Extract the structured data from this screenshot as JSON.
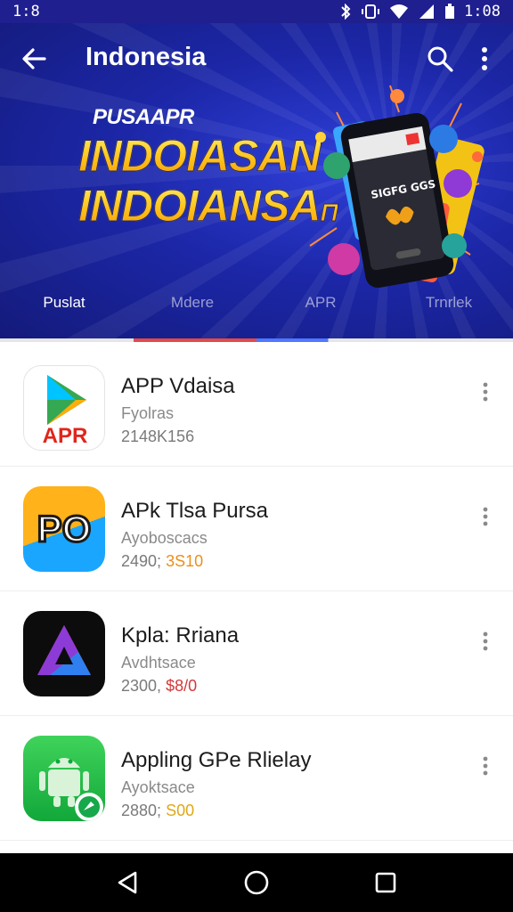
{
  "status_bar": {
    "time_left": "1:8",
    "time_right": "1:08",
    "icons": [
      "bluetooth-icon",
      "vibrate-icon",
      "wifi-icon",
      "signal-icon",
      "battery-icon"
    ]
  },
  "header": {
    "title": "Indonesia",
    "back_icon": "arrow-left-icon",
    "search_icon": "search-icon",
    "more_icon": "more-vertical-icon"
  },
  "banner": {
    "small_text": "PUSAAPR",
    "line1": "INDOIASAN",
    "line2": "INDOIANSA",
    "line2_suffix": "П",
    "phone_screen_text": "SIGFG GGS"
  },
  "tabs": [
    {
      "label": "Puslat",
      "active": true
    },
    {
      "label": "Mdere",
      "active": false
    },
    {
      "label": "APR",
      "active": false
    },
    {
      "label": "Trnrlek",
      "active": false
    }
  ],
  "apps": [
    {
      "name": "APP Vdaisa",
      "subtitle": "Fyolras",
      "meta_plain": "2148K156",
      "meta_highlight": "",
      "icon": "play-store-icon",
      "icon_text": "APR"
    },
    {
      "name": "APk Tlsa Pursa",
      "subtitle": "Ayoboscacs",
      "meta_plain": "2490;",
      "meta_highlight": "3S10",
      "icon": "po-logo-icon",
      "icon_text": "PO"
    },
    {
      "name": "Kpla: Rriana",
      "subtitle": "Avdhtsace",
      "meta_plain": "2300,",
      "meta_highlight": "$8/0",
      "icon": "triangle-logo-icon",
      "icon_text": ""
    },
    {
      "name": "Appling GPe Rlielay",
      "subtitle": "Ayoktsace",
      "meta_plain": "2880;",
      "meta_highlight": "S00",
      "icon": "android-robot-icon",
      "icon_text": ""
    }
  ],
  "nav_bar": {
    "icons": [
      "back-triangle-icon",
      "home-circle-icon",
      "recents-square-icon"
    ]
  },
  "colors": {
    "banner_blue": "#1c27a8",
    "highlight_orange": "#e98f1c",
    "highlight_red": "#d23a3a",
    "highlight_yellow": "#e0a815"
  }
}
